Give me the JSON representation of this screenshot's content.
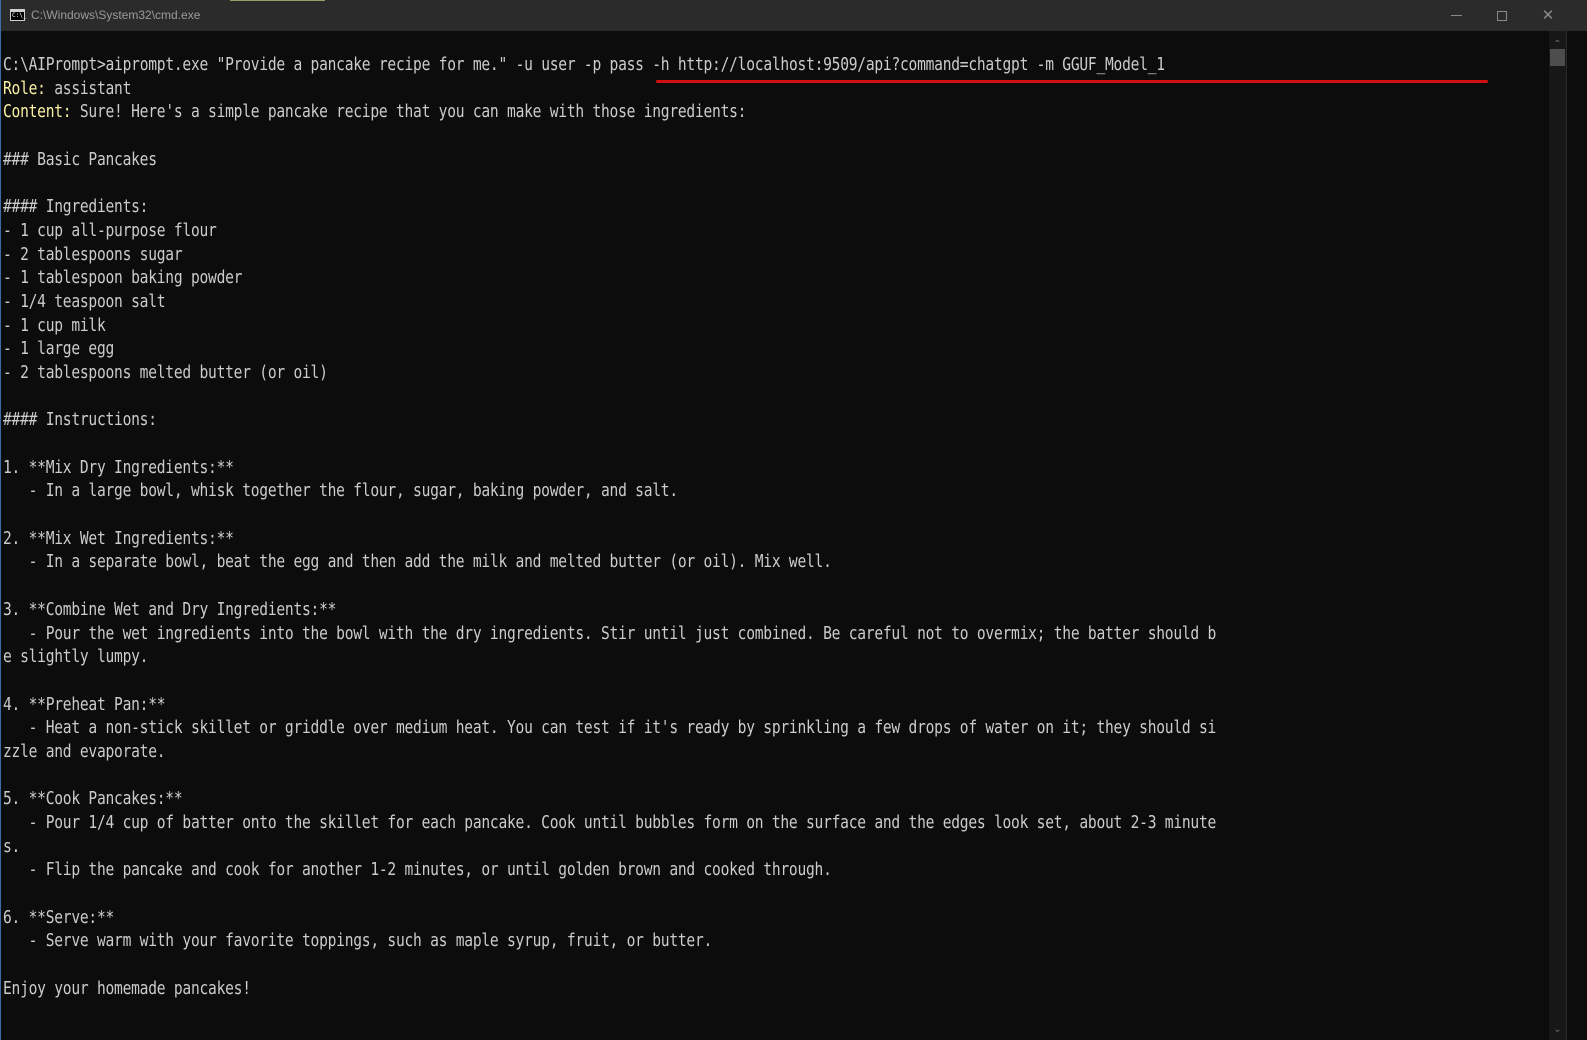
{
  "window": {
    "title": "C:\\Windows\\System32\\cmd.exe",
    "icon": "cmd-icon",
    "icon_text": "C:\\_",
    "controls": {
      "minimize": "minimize-icon",
      "maximize": "maximize-icon",
      "close": "close-icon",
      "close_glyph": "✕"
    }
  },
  "colors": {
    "background": "#0c0c0c",
    "text": "#cccccc",
    "label": "#f9f1a5",
    "underline": "#d01010",
    "titlebar": "#2b2b2b"
  },
  "console": {
    "prompt": "C:\\AIPrompt>",
    "command": "aiprompt.exe \"Provide a pancake recipe for me.\" ",
    "command_args": "-u user -p pass -h http://localhost:9509/api?command=chatgpt -m GGUF_Model_1",
    "role_label": "Role:",
    "role_value": " assistant",
    "content_label": "Content:",
    "content_value": " Sure! Here's a simple pancake recipe that you can make with those ingredients:",
    "lines": [
      "",
      "### Basic Pancakes",
      "",
      "#### Ingredients:",
      "- 1 cup all-purpose flour",
      "- 2 tablespoons sugar",
      "- 1 tablespoon baking powder",
      "- 1/4 teaspoon salt",
      "- 1 cup milk",
      "- 1 large egg",
      "- 2 tablespoons melted butter (or oil)",
      "",
      "#### Instructions:",
      "",
      "1. **Mix Dry Ingredients:**",
      "   - In a large bowl, whisk together the flour, sugar, baking powder, and salt.",
      "",
      "2. **Mix Wet Ingredients:**",
      "   - In a separate bowl, beat the egg and then add the milk and melted butter (or oil). Mix well.",
      "",
      "3. **Combine Wet and Dry Ingredients:**",
      "   - Pour the wet ingredients into the bowl with the dry ingredients. Stir until just combined. Be careful not to overmix; the batter should b",
      "e slightly lumpy.",
      "",
      "4. **Preheat Pan:**",
      "   - Heat a non-stick skillet or griddle over medium heat. You can test if it's ready by sprinkling a few drops of water on it; they should si",
      "zzle and evaporate.",
      "",
      "5. **Cook Pancakes:**",
      "   - Pour 1/4 cup of batter onto the skillet for each pancake. Cook until bubbles form on the surface and the edges look set, about 2-3 minute",
      "s.",
      "   - Flip the pancake and cook for another 1-2 minutes, or until golden brown and cooked through.",
      "",
      "6. **Serve:**",
      "   - Serve warm with your favorite toppings, such as maple syrup, fruit, or butter.",
      "",
      "Enjoy your homemade pancakes!"
    ]
  },
  "scrollbar": {
    "up_glyph": "⌃",
    "down_glyph": "⌄",
    "position_fraction": 0.0
  }
}
